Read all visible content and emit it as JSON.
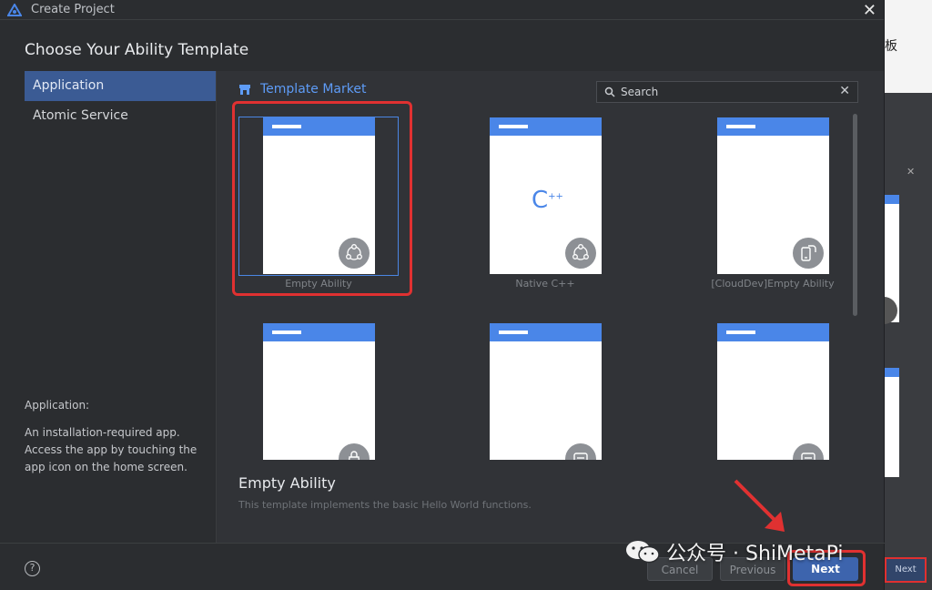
{
  "window": {
    "title": "Create Project"
  },
  "heading": "Choose Your Ability Template",
  "sidebar": {
    "items": [
      {
        "label": "Application",
        "active": true
      },
      {
        "label": "Atomic Service",
        "active": false
      }
    ],
    "description_title": "Application:",
    "description_body": "An installation-required app. Access the app by touching the app icon on the home screen."
  },
  "market": {
    "title": "Template Market",
    "icon": "store-icon"
  },
  "search": {
    "placeholder": "Search",
    "icon": "search-icon"
  },
  "templates": [
    {
      "label": "Empty Ability",
      "icon": "ability-icon",
      "selected": true
    },
    {
      "label": "Native C++",
      "icon": "ability-icon",
      "center_glyph": "C",
      "center_sup": "++"
    },
    {
      "label": "[CloudDev]Empty Ability",
      "icon": "cloud-device-icon"
    },
    {
      "label": "",
      "icon": "bag-icon"
    },
    {
      "label": "",
      "icon": "card-icon"
    },
    {
      "label": "",
      "icon": "card-icon"
    }
  ],
  "selected_template": {
    "title": "Empty Ability",
    "description": "This template implements the basic Hello World functions."
  },
  "footer": {
    "help": "?",
    "cancel": "Cancel",
    "previous": "Previous",
    "next": "Next"
  },
  "watermark": {
    "text": "公众号 · ShiMetaPi"
  },
  "background": {
    "char": "板",
    "next": "Next"
  },
  "colors": {
    "accent": "#4a86e8",
    "selected_sidebar": "#3b5b94",
    "next_button": "#3d64ad",
    "highlight": "#e03131"
  }
}
